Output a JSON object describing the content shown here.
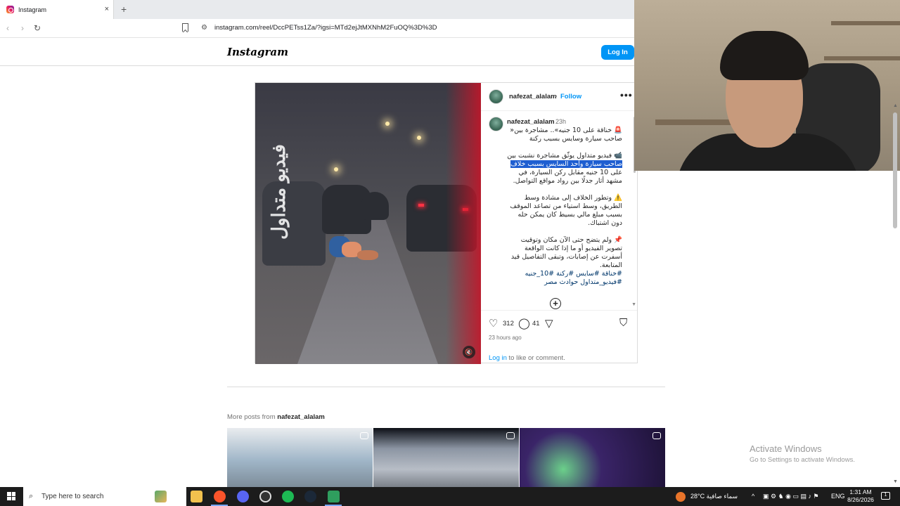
{
  "browser": {
    "tab_title": "Instagram",
    "tab_close": "×",
    "new_tab": "+",
    "url": "instagram.com/reel/DccPETss1Za/?igsi=MTd2ejJtMXNhM2FuOQ%3D%3D",
    "back": "‹",
    "forward": "›",
    "reload": "↻"
  },
  "header": {
    "logo": "Instagram",
    "login_button": "Log In"
  },
  "post": {
    "username": "nafezat_alalam",
    "follow_sep": "•",
    "follow": "Follow",
    "more": "•••",
    "video_overlay": "فيديو متداول",
    "caption": {
      "username": "nafezat_alalam",
      "time": "23h",
      "line1": "🚨 خناقة على 10 جنيه».. مشاجرة بين« صاحب سيارة وسايس بسبب ركنة",
      "para2_pre": "📹 فيديو متداول يوثّق مشاجرة نشبت بين ",
      "para2_hl": "صاحب سيارة وأحد السايس بسبب خلاف",
      "para2_post": " على 10 جنيه مقابل ركن السيارة، في مشهد أثار جدلًا بين رواد مواقع التواصل.",
      "para3": "⚠️ وتطور الخلاف إلى مشادة وسط الطريق، وسط استياء من تصاعد الموقف بسبب مبلغ مالي بسيط كان يمكن حله دون اشتباك.",
      "para4": "📌 ولم يتضح حتى الآن مكان وتوقيت تصوير الفيديو أو ما إذا كانت الواقعة أسفرت عن إصابات، وتبقى التفاصيل قيد المتابعة.",
      "hashtags1": "#خناقة #سايس #ركنة #10_جنيه",
      "hashtags2": "#فيديو_متداول حوادث مصر"
    },
    "likes": "312",
    "comments": "41",
    "ago": "23 hours ago",
    "login_link": "Log in",
    "login_rest": " to like or comment."
  },
  "more_posts": {
    "prefix": "More posts from ",
    "user": "nafezat_alalam"
  },
  "watermark": {
    "title": "Activate Windows",
    "subtitle": "Go to Settings to activate Windows."
  },
  "taskbar": {
    "search_placeholder": "Type here to search",
    "weather": "28°C  سماء صافية",
    "lang": "ENG",
    "time": "1:31 AM",
    "date": "8/26/2026",
    "notifications": "1"
  }
}
